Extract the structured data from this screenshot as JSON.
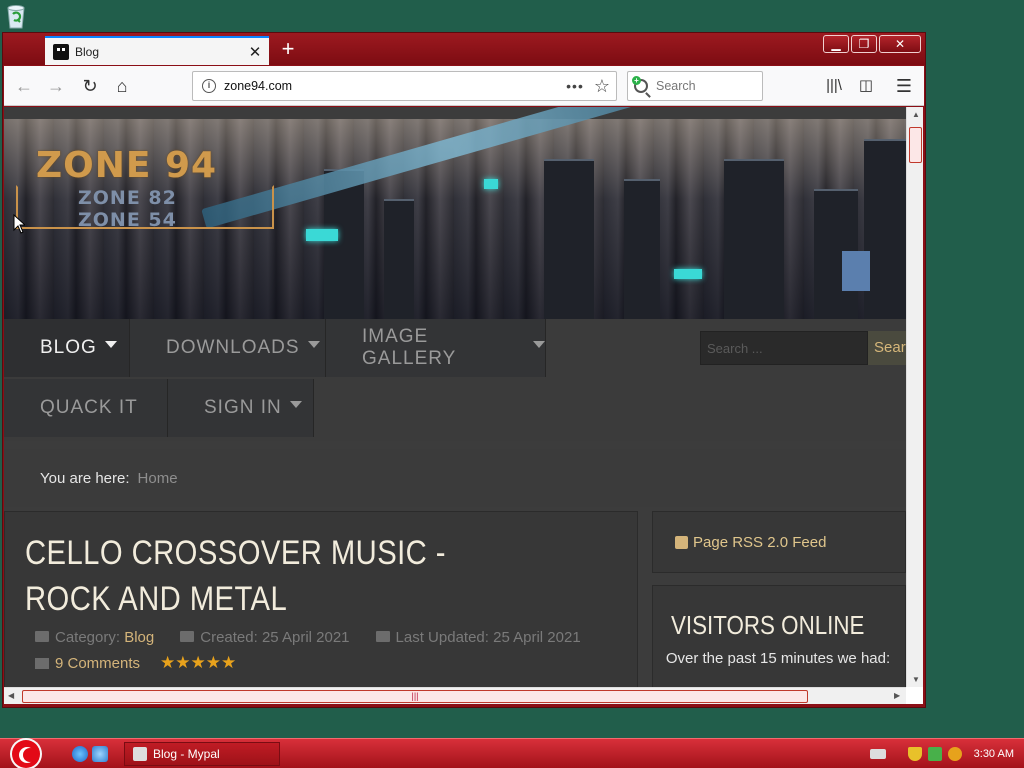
{
  "browser": {
    "tab_title": "Blog",
    "tab_close": "✕",
    "new_tab": "+",
    "url": "zone94.com",
    "url_more": "•••",
    "search_placeholder": "Search"
  },
  "site": {
    "logo_main": "ZONE 94",
    "logo_sub1": "ZONE 82",
    "logo_sub2": "ZONE 54",
    "menu": [
      {
        "label": "BLOG",
        "has_caret": true,
        "active": true
      },
      {
        "label": "DOWNLOADS",
        "has_caret": true
      },
      {
        "label": "IMAGE GALLERY",
        "has_caret": true
      },
      {
        "label": "QUACK IT",
        "has_caret": false
      },
      {
        "label": "SIGN IN",
        "has_caret": true
      }
    ],
    "search_placeholder": "Search ...",
    "search_button": "Search",
    "breadcrumb_label": "You are here:",
    "breadcrumb_home": "Home"
  },
  "article": {
    "title": "CELLO CROSSOVER MUSIC - ROCK AND METAL",
    "category_label": "Category:",
    "category": "Blog",
    "created": "Created: 25 April 2021",
    "updated": "Last Updated: 25 April 2021",
    "comments": "9 Comments",
    "rating_stars": "★★★★★"
  },
  "sidebar": {
    "rss": "Page RSS 2.0 Feed",
    "visitors_title": "VISITORS ONLINE",
    "visitors_text": "Over the past 15 minutes we had:"
  },
  "taskbar": {
    "task_label": "Blog - Mypal",
    "clock": "3:30 AM"
  },
  "colors": {
    "desktop": "#215e4b",
    "window_frame": "#8b0f16",
    "accent_gold": "#d4b47a",
    "taskbar": "#c41f28"
  }
}
